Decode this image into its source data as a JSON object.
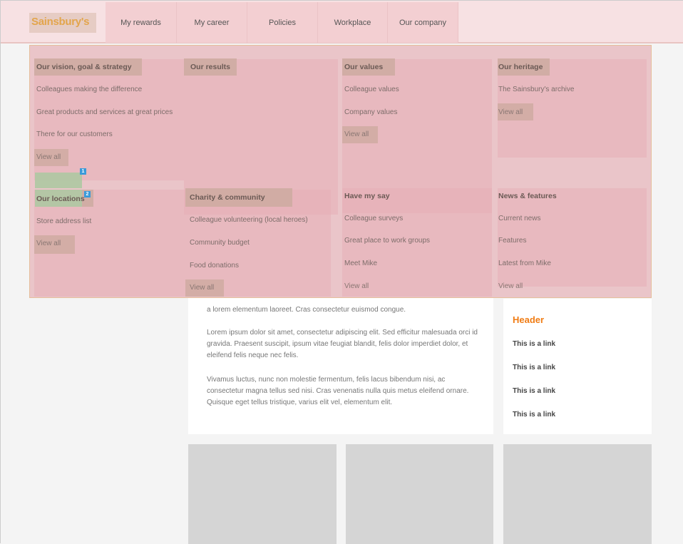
{
  "brand": {
    "name": "Sainsbury's",
    "color": "#e3a54c"
  },
  "nav": [
    {
      "label": "My rewards"
    },
    {
      "label": "My career"
    },
    {
      "label": "Policies"
    },
    {
      "label": "Workplace"
    },
    {
      "label": "Our company"
    }
  ],
  "mega_menu": {
    "sections": [
      {
        "title": "Our vision, goal & strategy",
        "links": [
          "Colleagues making the difference",
          "Great products and services at great prices",
          "There for our customers"
        ],
        "view_all": "View all"
      },
      {
        "title": "Our results",
        "links": [],
        "view_all": ""
      },
      {
        "title": "Our values",
        "links": [
          "Colleague values",
          "Company values"
        ],
        "view_all": "View all"
      },
      {
        "title": "Our heritage",
        "links": [
          "The Sainsbury's archive"
        ],
        "view_all": "View all"
      },
      {
        "title": "Our locations",
        "links": [
          "Store address list"
        ],
        "view_all": "View all"
      },
      {
        "title": "Charity & community",
        "links": [
          "Colleague volunteering (local heroes)",
          "Community budget",
          "Food donations"
        ],
        "view_all": "View all"
      },
      {
        "title": "Have my say",
        "links": [
          "Colleague surveys",
          "Great place to work groups",
          "Meet Mike"
        ],
        "view_all": "View all"
      },
      {
        "title": "News & features",
        "links": [
          "Current news",
          "Features",
          "Latest from Mike"
        ],
        "view_all": "View all"
      }
    ],
    "badges": [
      "1",
      "2"
    ]
  },
  "main": {
    "paragraphs": [
      "a lorem elementum laoreet. Cras consectetur euismod congue.",
      "Lorem ipsum dolor sit amet, consectetur adipiscing elit. Sed efficitur malesuada orci id gravida. Praesent suscipit, ipsum vitae feugiat blandit, felis dolor imperdiet dolor, et eleifend felis neque nec felis.",
      "Vivamus luctus, nunc non molestie fermentum, felis lacus bibendum nisi, ac consectetur magna tellus sed nisi. Cras venenatis nulla quis metus eleifend ornare. Quisque eget tellus tristique, varius elit vel, elementum elit."
    ]
  },
  "sidebar": {
    "header": "Header",
    "header_color": "#f07c14",
    "links": [
      "This is a link",
      "This is a link",
      "This is a link",
      "This is a link"
    ]
  }
}
